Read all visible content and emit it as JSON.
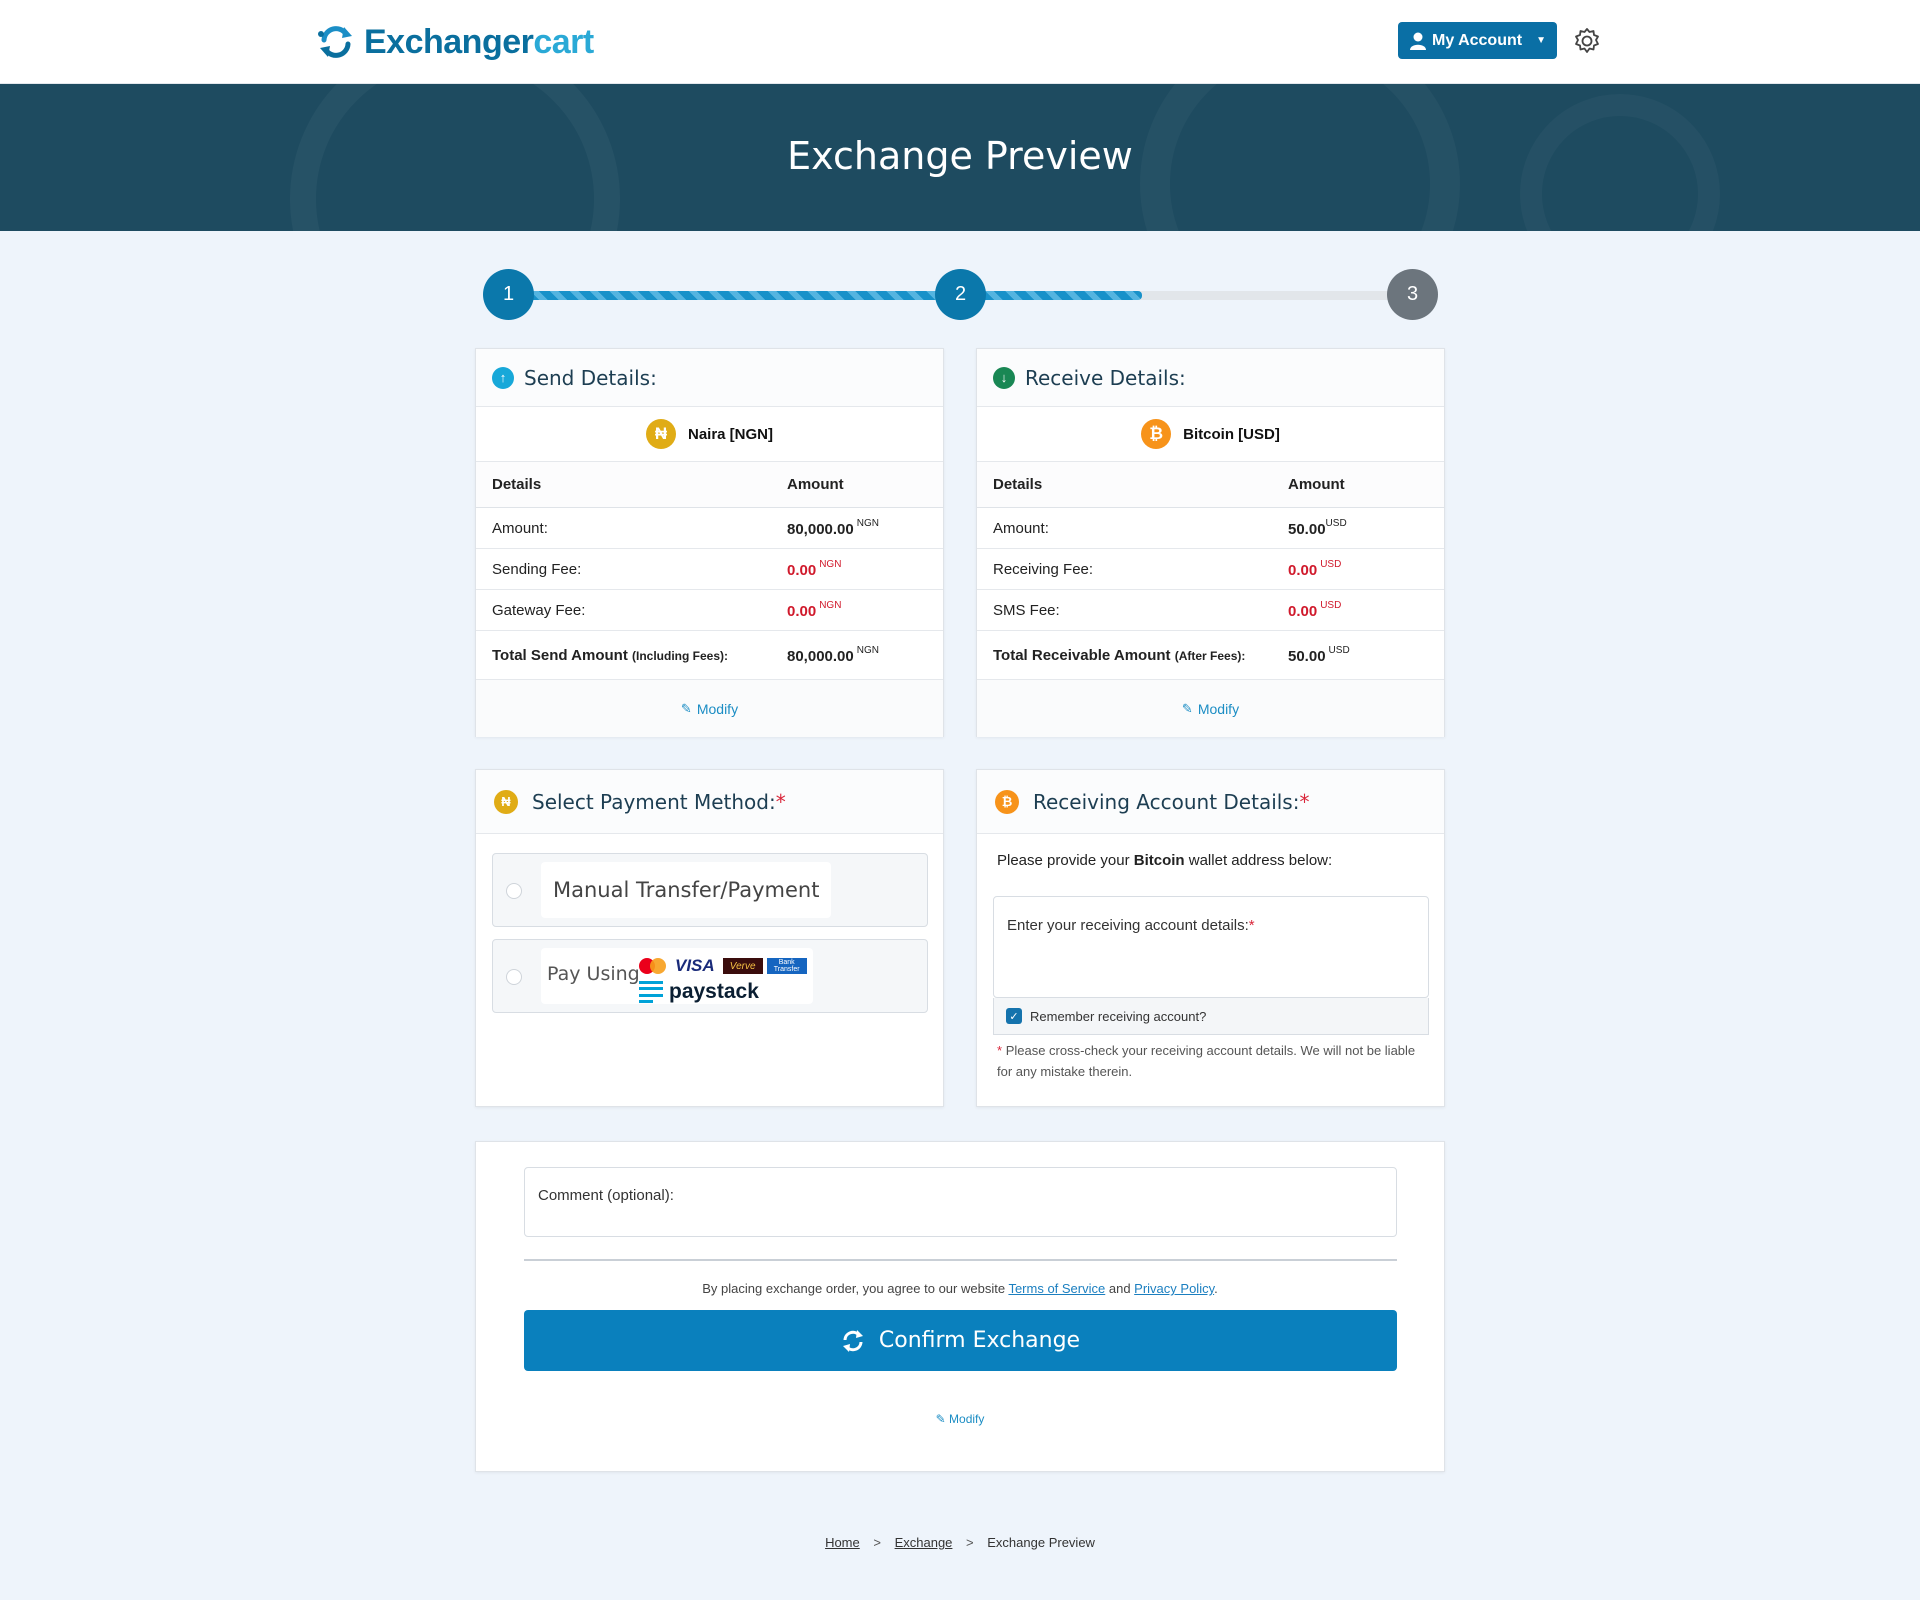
{
  "header": {
    "logo_part1": "Exchanger",
    "logo_part2": "cart",
    "account_label": "My Account"
  },
  "banner": {
    "title": "Exchange Preview"
  },
  "progress": {
    "steps": [
      "1",
      "2",
      "3"
    ],
    "current_step": 2,
    "fill_fraction": 0.7
  },
  "send": {
    "title": "Send Details:",
    "currency": "Naira [NGN]",
    "col_details": "Details",
    "col_amount": "Amount",
    "rows": [
      {
        "label": "Amount:",
        "value": "80,000.00",
        "unit": "NGN"
      },
      {
        "label": "Sending Fee:",
        "value": "0.00",
        "unit": "NGN"
      },
      {
        "label": "Gateway Fee:",
        "value": "0.00",
        "unit": "NGN"
      }
    ],
    "total_label": "Total Send Amount",
    "total_note": "(Including Fees):",
    "total_value": "80,000.00",
    "total_unit": "NGN",
    "modify": "Modify"
  },
  "receive": {
    "title": "Receive Details:",
    "currency": "Bitcoin [USD]",
    "col_details": "Details",
    "col_amount": "Amount",
    "rows": [
      {
        "label": "Amount:",
        "value": "50.00",
        "unit": "USD"
      },
      {
        "label": "Receiving Fee:",
        "value": "0.00",
        "unit": "USD"
      },
      {
        "label": "SMS Fee:",
        "value": "0.00",
        "unit": "USD"
      }
    ],
    "total_label": "Total Receivable Amount",
    "total_note": "(After Fees):",
    "total_value": "50.00",
    "total_unit": "USD",
    "modify": "Modify"
  },
  "payment": {
    "title": "Select Payment Method:",
    "required": "*",
    "option1": "Manual Transfer/Payment",
    "option2_prefix": "Pay Using",
    "visa": "VISA",
    "verve": "Verve",
    "bank_transfer": "Bank Transfer",
    "paystack": "paystack"
  },
  "receiving_account": {
    "title": "Receiving Account Details:",
    "required": "*",
    "intro_before": "Please provide your ",
    "intro_bold": "Bitcoin",
    "intro_after": " wallet address below:",
    "field_label": "Enter your receiving account details:",
    "remember": "Remember receiving account?",
    "note_star": "*",
    "note": "Please cross-check your receiving account details. We will not be liable for any mistake therein."
  },
  "bottom": {
    "comment_label": "Comment (optional):",
    "agree_before": "By placing exchange order, you agree to our website ",
    "terms": "Terms of Service",
    "agree_and": " and ",
    "privacy": "Privacy Policy",
    "agree_end": ".",
    "confirm": "Confirm Exchange",
    "modify": "Modify"
  },
  "breadcrumb": {
    "home": "Home",
    "exchange": "Exchange",
    "current": "Exchange Preview",
    "sep": ">"
  },
  "colors": {
    "primary": "#0a80bd",
    "header_banner": "#1e4b60",
    "fee_red": "#d0192b",
    "naira_coin": "#e0ac16",
    "bitcoin_coin": "#f7931a"
  }
}
